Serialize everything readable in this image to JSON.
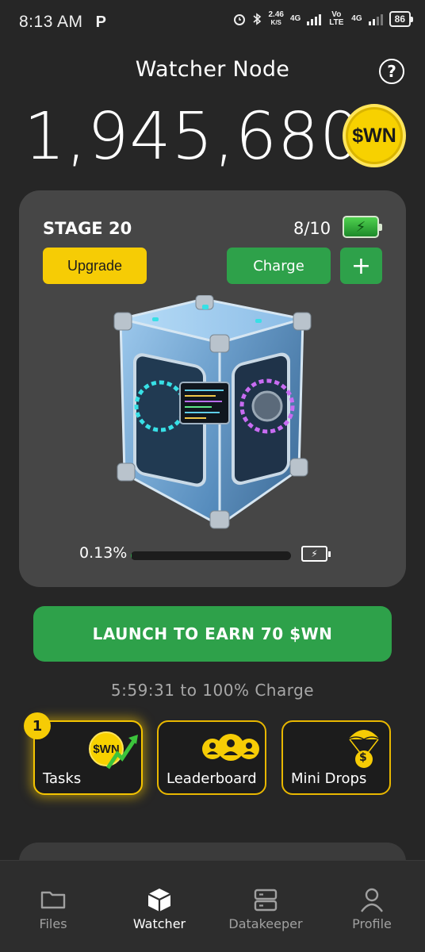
{
  "status_bar": {
    "time": "8:13 AM",
    "app_icon": "P",
    "speed_value": "2.46",
    "speed_unit": "K/S",
    "net1": "4G",
    "net2": "Vo LTE",
    "net3": "4G",
    "battery": "86"
  },
  "header": {
    "title": "Watcher Node",
    "help_icon": "?"
  },
  "balance": {
    "amount": "1,945,680",
    "token_symbol": "$WN",
    "coin_color": "#f7d100"
  },
  "stage": {
    "label": "STAGE 20",
    "charges": "8/10",
    "upgrade_label": "Upgrade",
    "charge_label": "Charge",
    "plus_label": "+",
    "progress_text": "0.13%",
    "progress_fraction": 0.0013
  },
  "launch": {
    "label": "LAUNCH TO EARN 70 $WN",
    "timer_text": "5:59:31  to 100% Charge"
  },
  "tiles": {
    "badge_count": "1",
    "tasks_label": "Tasks",
    "tasks_coin": "$WN",
    "leaderboard_label": "Leaderboard",
    "mini_drops_label": "Mini Drops",
    "mini_drops_coin": "$"
  },
  "nav": {
    "items": [
      {
        "label": "Files",
        "icon": "folder-icon"
      },
      {
        "label": "Watcher",
        "icon": "cube-icon"
      },
      {
        "label": "Datakeeper",
        "icon": "server-icon"
      },
      {
        "label": "Profile",
        "icon": "person-icon"
      }
    ],
    "active": "Watcher"
  },
  "colors": {
    "accent_green": "#2ea14a",
    "accent_yellow": "#f6cc05",
    "card_bg": "#464646",
    "page_bg": "#262626"
  }
}
